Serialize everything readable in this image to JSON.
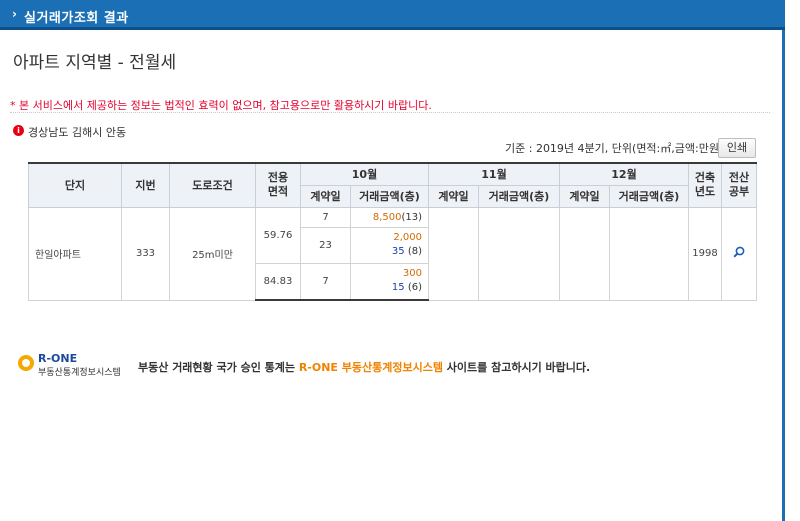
{
  "header": {
    "arrow": "›",
    "title": "실거래가조회 결과"
  },
  "page_title": "아파트 지역별 - 전월세",
  "notice": "* 본 서비스에서 제공하는 정보는 법적인 효력이 없으며, 참고용으로만 활용하시기 바랍니다.",
  "location": {
    "icon": "alert-icon",
    "text": "경상남도 김해시 안동"
  },
  "basis": "기준 : 2019년 4분기, 단위(면적:㎡,금액:만원)",
  "print_label": "인쇄",
  "table": {
    "headers": {
      "complex": "단지",
      "lot": "지번",
      "road": "도로조건",
      "area": "전용\n면적",
      "oct": "10월",
      "nov": "11월",
      "dec": "12월",
      "built": "건축\n년도",
      "ledger": "전산\n공부",
      "contract_day": "계약일",
      "amount": "거래금액(층)"
    },
    "rows": [
      {
        "area": "59.76",
        "day": "7",
        "amount": "8,500",
        "floor": "(13)"
      },
      {
        "area": "",
        "day": "23",
        "deposit": "2,000",
        "rent": "35",
        "floor": "(8)"
      },
      {
        "area": "84.83",
        "day": "7",
        "deposit": "300",
        "rent": "15",
        "floor": "(6)"
      }
    ],
    "complex_name": "한일아파트",
    "lot_no": "333",
    "road_cond": "25m미만",
    "built_year": "1998"
  },
  "rone": {
    "name": "R-ONE",
    "subtitle": "부동산통계정보시스템",
    "text_before": "부동산 거래현황 국가 승인 통계는 ",
    "highlight": "R-ONE 부동산통계정보시스템",
    "text_after": " 사이트를 참고하시기 바랍니다."
  },
  "colors": {
    "header_bg": "#1a6fb5",
    "notice": "#e4002b",
    "amount_sale": "#d16b00",
    "amount_rent": "#1c3fa8",
    "rone_accent": "#f08300"
  }
}
